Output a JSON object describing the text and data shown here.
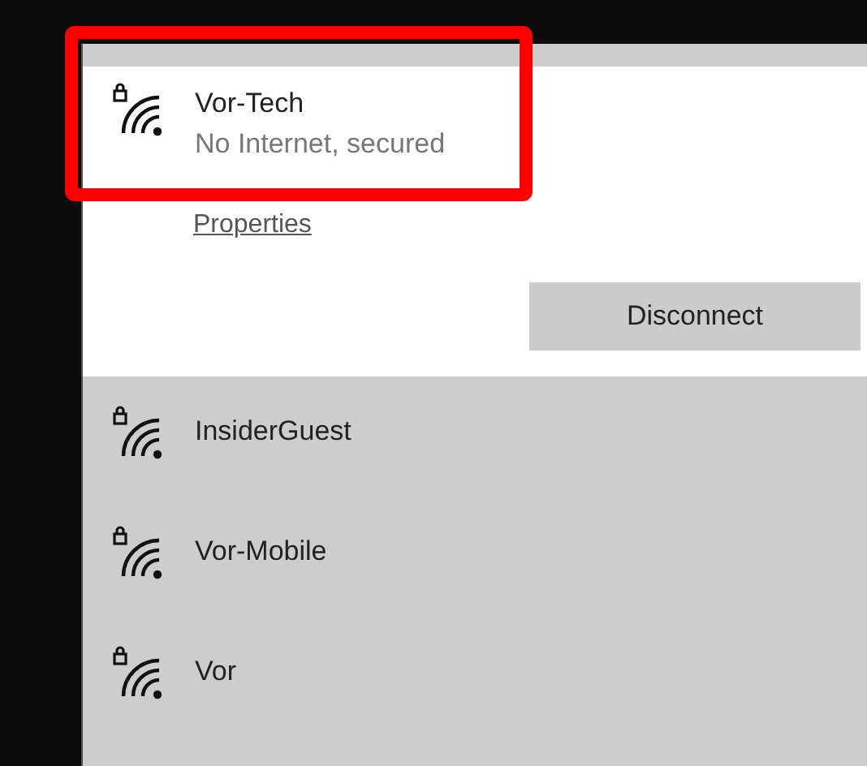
{
  "connected_network": {
    "name": "Vor-Tech",
    "status": "No Internet, secured",
    "highlighted": true,
    "properties_link": "Properties",
    "disconnect_button": "Disconnect"
  },
  "networks": [
    {
      "name": "InsiderGuest"
    },
    {
      "name": "Vor-Mobile"
    },
    {
      "name": "Vor"
    }
  ]
}
